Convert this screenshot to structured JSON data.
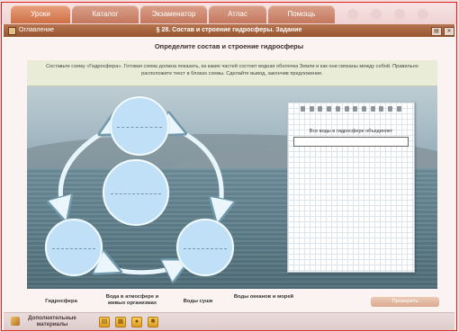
{
  "tabs": [
    {
      "label": "Уроки",
      "active": true
    },
    {
      "label": "Каталог",
      "active": false
    },
    {
      "label": "Экзаменатор",
      "active": false
    },
    {
      "label": "Атлас",
      "active": false
    },
    {
      "label": "Помощь",
      "active": false
    }
  ],
  "titlebar": {
    "contents_label": "Оглавление",
    "title": "§ 28. Состав и строение гидросферы. Задание",
    "print_icon": "printer-icon",
    "close_icon": "close-icon"
  },
  "task": {
    "heading": "Определите состав и строение гидросферы",
    "instruction": "Составьте схему «Гидросфера». Готовая схема должна показать, из каких частей состоит водная оболочка Земли и как они связаны между собой. Правильно расположите текст в блоках схемы. Сделайте вывод, закончив предложение."
  },
  "notebook": {
    "prompt": "Все воды в гидросфере объединяет",
    "answer_value": ""
  },
  "draggable_labels": [
    "Гидросфера",
    "Вода в атмосфере и живых организмах",
    "Воды суши",
    "Воды океанов и морей"
  ],
  "check_button": "Проверить",
  "bottombar": {
    "materials_label": "Дополнительные материалы",
    "tools": [
      "book-icon",
      "notes-icon",
      "globe-icon",
      "star-icon"
    ]
  },
  "colors": {
    "accent": "#c4785e",
    "titlebar": "#a5643f",
    "frame_border": "#e02020",
    "circle_fill": "#bfe0f7"
  }
}
